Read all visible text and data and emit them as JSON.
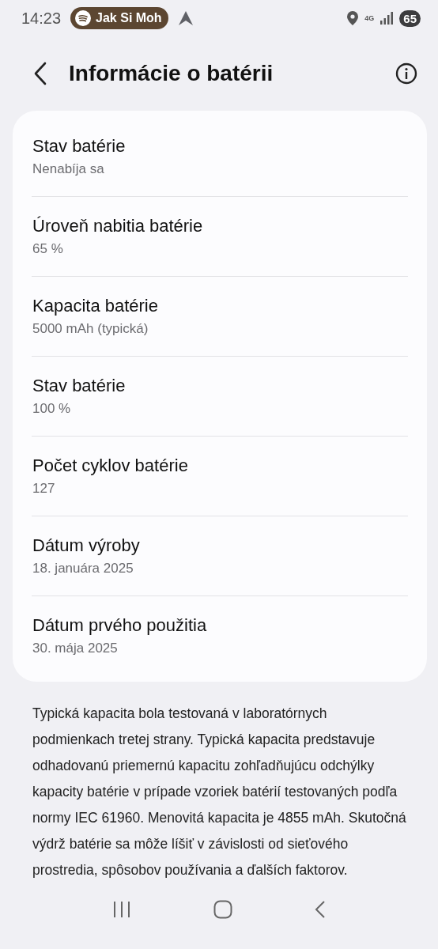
{
  "status_bar": {
    "time": "14:23",
    "media_chip": "Jak Si Moh",
    "network": "4G",
    "battery": "65"
  },
  "header": {
    "title": "Informácie o batérii"
  },
  "items": [
    {
      "title": "Stav batérie",
      "value": "Nenabíja sa"
    },
    {
      "title": "Úroveň nabitia batérie",
      "value": "65 %"
    },
    {
      "title": "Kapacita batérie",
      "value": "5000 mAh (typická)"
    },
    {
      "title": "Stav batérie",
      "value": "100 %"
    },
    {
      "title": "Počet cyklov batérie",
      "value": "127"
    },
    {
      "title": "Dátum výroby",
      "value": "18. januára 2025"
    },
    {
      "title": "Dátum prvého použitia",
      "value": "30. mája 2025"
    }
  ],
  "note": "Typická kapacita bola testovaná v laboratórnych podmienkach tretej strany. Typická kapacita predstavuje odhadovanú priemernú kapacitu zohľadňujúcu odchýlky kapacity batérie v prípade vzoriek batérií testovaných podľa normy IEC 61960. Menovitá kapacita je 4855 mAh. Skutočná výdrž batérie sa môže líšiť v závislosti od sieťového prostredia, spôsobov používania a ďalších faktorov."
}
